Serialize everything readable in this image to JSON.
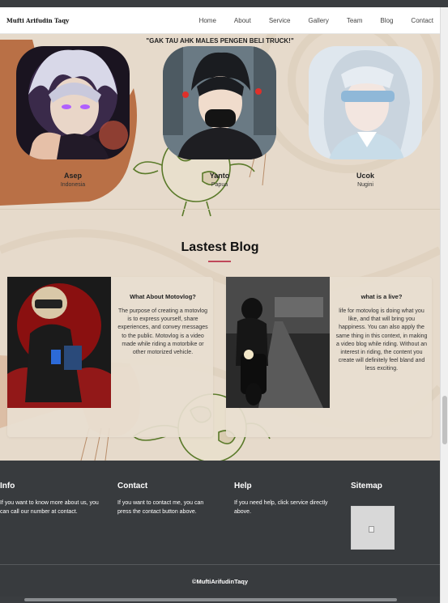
{
  "header": {
    "brand": "Mufti Arifudin Taqy",
    "nav": [
      "Home",
      "About",
      "Service",
      "Gallery",
      "Team",
      "Blog",
      "Contact"
    ]
  },
  "team": {
    "quote": "\"GAK TAU AHK MALES PENGEN BELI TRUCK!\"",
    "members": [
      {
        "name": "Asep",
        "country": "Indonesia"
      },
      {
        "name": "Yanto",
        "country": "Papua"
      },
      {
        "name": "Ucok",
        "country": "Nugini"
      }
    ]
  },
  "blog": {
    "title": "Lastest Blog",
    "accent": "#c0485a",
    "posts": [
      {
        "title": "What About Motovlog?",
        "body": "The purpose of creating a motovlog is to express yourself, share experiences, and convey messages to the public. Motovlog is a video made while riding a motorbike or other motorized vehicle."
      },
      {
        "title": "what is a live?",
        "body": "life for motovlog is doing what you like, and that will bring you happiness. You can also apply the same thing in this context, in making a video blog while riding. Without an interest in riding, the content you create will definitely feel bland and less exciting."
      }
    ]
  },
  "footer": {
    "columns": [
      {
        "title": "Info",
        "text": "If you want to know more about us, you can call our number at contact."
      },
      {
        "title": "Contact",
        "text": "If you want to contact me, you can press the contact button above."
      },
      {
        "title": "Help",
        "text": "If you need help, click service directly above."
      },
      {
        "title": "Sitemap",
        "text": ""
      }
    ],
    "copyright": "©MuftiArifudinTaqy",
    "background": "#383b3e"
  },
  "icons": [
    "broken-image-icon"
  ]
}
